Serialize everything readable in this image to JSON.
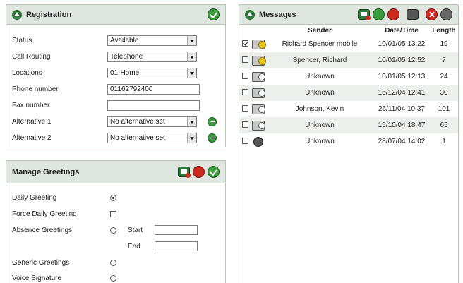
{
  "registration": {
    "title": "Registration",
    "status_label": "Status",
    "status_value": "Available",
    "call_routing_label": "Call Routing",
    "call_routing_value": "Telephone",
    "locations_label": "Locations",
    "locations_value": "01-Home",
    "phone_label": "Phone number",
    "phone_value": "01162792400",
    "fax_label": "Fax number",
    "fax_value": "",
    "alt1_label": "Alternative 1",
    "alt1_value": "No alternative set",
    "alt2_label": "Alternative 2",
    "alt2_value": "No alternative set"
  },
  "greetings": {
    "title": "Manage Greetings",
    "daily_label": "Daily Greeting",
    "force_daily_label": "Force Daily Greeting",
    "absence_label": "Absence Greetings",
    "start_label": "Start",
    "end_label": "End",
    "generic_label": "Generic Greetings",
    "voice_signature_label": "Voice Signature"
  },
  "messages": {
    "title": "Messages",
    "columns": {
      "sender": "Sender",
      "datetime": "Date/Time",
      "length": "Length"
    },
    "rows": [
      {
        "checked": true,
        "icon": "voicemail-new-icon",
        "sender": "Richard Spencer mobile",
        "datetime": "10/01/05 13:22",
        "length": "19"
      },
      {
        "checked": false,
        "icon": "voicemail-new-icon",
        "sender": "Spencer, Richard",
        "datetime": "10/01/05 12:52",
        "length": "7"
      },
      {
        "checked": false,
        "icon": "voicemail-old-icon",
        "sender": "Unknown",
        "datetime": "10/01/05 12:13",
        "length": "24"
      },
      {
        "checked": false,
        "icon": "voicemail-old-icon",
        "sender": "Unknown",
        "datetime": "16/12/04 12:41",
        "length": "30"
      },
      {
        "checked": false,
        "icon": "voicemail-old-icon",
        "sender": "Johnson, Kevin",
        "datetime": "26/11/04 10:37",
        "length": "101"
      },
      {
        "checked": false,
        "icon": "voicemail-old-icon",
        "sender": "Unknown",
        "datetime": "15/10/04 18:47",
        "length": "65"
      },
      {
        "checked": false,
        "icon": "fax-icon",
        "sender": "Unknown",
        "datetime": "28/07/04 14:02",
        "length": "1"
      }
    ]
  },
  "colors": {
    "header_bg": "#dfe6df",
    "accent_green": "#3a9c3c",
    "accent_red": "#cc2a1e",
    "row_alt": "#edf1ed"
  }
}
